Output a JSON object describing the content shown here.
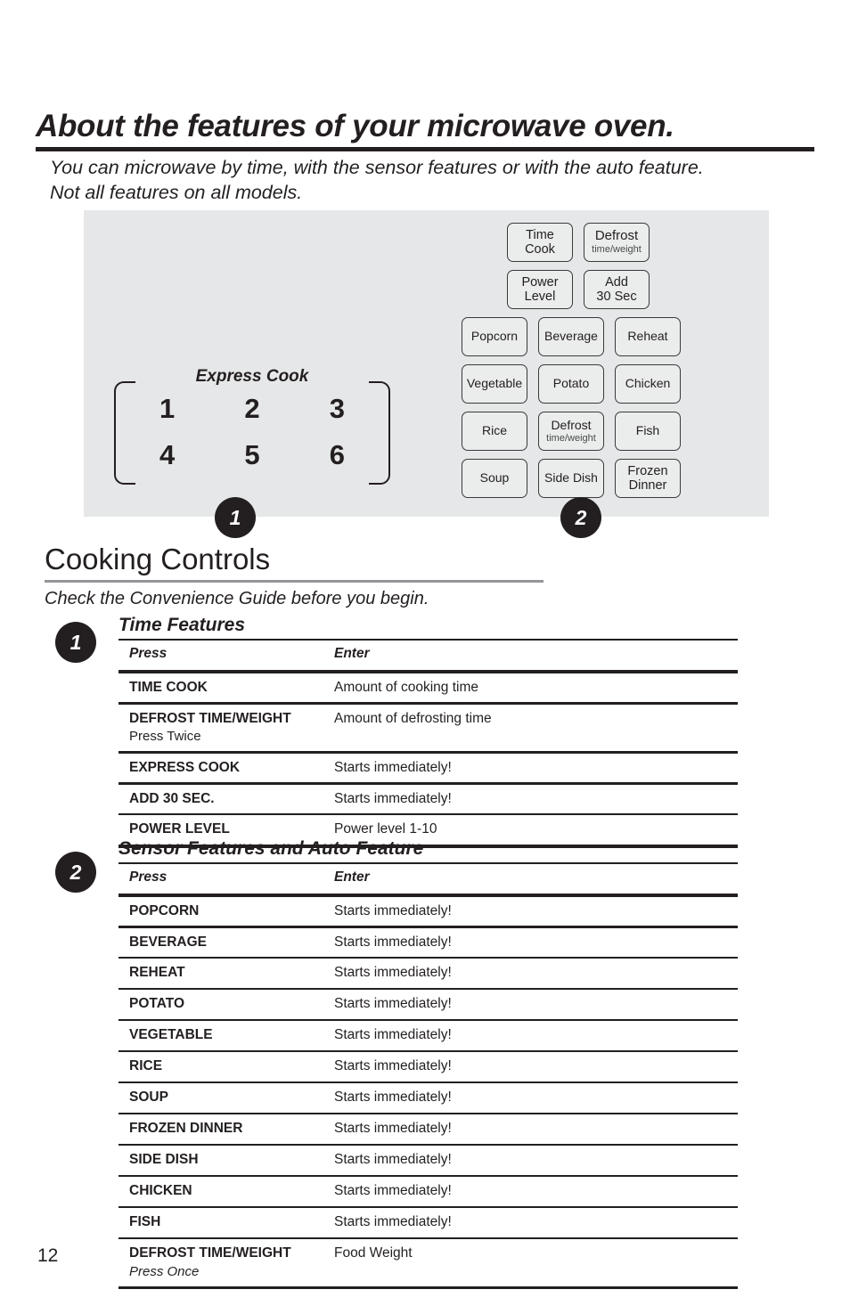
{
  "header": {
    "title": "About the features of your microwave oven.",
    "subtitle_line1": "You can microwave by time, with the sensor features or with the auto feature.",
    "subtitle_line2": "Not all features on all models."
  },
  "diagram": {
    "express": {
      "label": "Express Cook",
      "numbers": [
        "1",
        "2",
        "3",
        "4",
        "5",
        "6"
      ]
    },
    "keypad": {
      "row1": [
        {
          "main": "Time",
          "main2": "Cook",
          "sub": ""
        },
        {
          "main": "Defrost",
          "main2": "",
          "sub": "time/weight"
        }
      ],
      "row2": [
        {
          "main": "Power",
          "main2": "Level",
          "sub": ""
        },
        {
          "main": "Add",
          "main2": "30 Sec",
          "sub": ""
        }
      ],
      "row3": [
        {
          "main": "Popcorn",
          "main2": "",
          "sub": ""
        },
        {
          "main": "Beverage",
          "main2": "",
          "sub": ""
        },
        {
          "main": "Reheat",
          "main2": "",
          "sub": ""
        }
      ],
      "row4": [
        {
          "main": "Vegetable",
          "main2": "",
          "sub": ""
        },
        {
          "main": "Potato",
          "main2": "",
          "sub": ""
        },
        {
          "main": "Chicken",
          "main2": "",
          "sub": ""
        }
      ],
      "row5": [
        {
          "main": "Rice",
          "main2": "",
          "sub": ""
        },
        {
          "main": "Defrost",
          "main2": "",
          "sub": "time/weight"
        },
        {
          "main": "Fish",
          "main2": "",
          "sub": ""
        }
      ],
      "row6": [
        {
          "main": "Soup",
          "main2": "",
          "sub": ""
        },
        {
          "main": "Side Dish",
          "main2": "",
          "sub": ""
        },
        {
          "main": "Frozen",
          "main2": "Dinner",
          "sub": ""
        }
      ]
    },
    "badge_1": "1",
    "badge_2": "2"
  },
  "cooking_controls": {
    "title": "Cooking Controls",
    "subtitle": "Check the Convenience Guide before you begin."
  },
  "time_features": {
    "badge": "1",
    "heading": "Time Features",
    "columns": {
      "press": "Press",
      "enter": "Enter"
    },
    "rows": [
      {
        "press": "TIME COOK",
        "note": "",
        "note_italic": false,
        "enter": "Amount of cooking time"
      },
      {
        "press": "DEFROST TIME/WEIGHT",
        "note": "Press Twice",
        "note_italic": false,
        "enter": "Amount of defrosting time"
      },
      {
        "press": "EXPRESS COOK",
        "note": "",
        "note_italic": false,
        "enter": "Starts immediately!"
      },
      {
        "press": "ADD 30 SEC.",
        "note": "",
        "note_italic": false,
        "enter": "Starts immediately!"
      },
      {
        "press": "POWER LEVEL",
        "note": "",
        "note_italic": false,
        "enter": "Power level 1-10"
      }
    ]
  },
  "sensor_features": {
    "badge": "2",
    "heading": "Sensor Features and Auto Feature",
    "columns": {
      "press": "Press",
      "enter": "Enter"
    },
    "rows": [
      {
        "press": "POPCORN",
        "note": "",
        "note_italic": false,
        "enter": "Starts immediately!"
      },
      {
        "press": "BEVERAGE",
        "note": "",
        "note_italic": false,
        "enter": "Starts immediately!"
      },
      {
        "press": "REHEAT",
        "note": "",
        "note_italic": false,
        "enter": "Starts immediately!"
      },
      {
        "press": "POTATO",
        "note": "",
        "note_italic": false,
        "enter": "Starts immediately!"
      },
      {
        "press": "VEGETABLE",
        "note": "",
        "note_italic": false,
        "enter": "Starts immediately!"
      },
      {
        "press": "RICE",
        "note": "",
        "note_italic": false,
        "enter": "Starts immediately!"
      },
      {
        "press": "SOUP",
        "note": "",
        "note_italic": false,
        "enter": "Starts immediately!"
      },
      {
        "press": "FROZEN DINNER",
        "note": "",
        "note_italic": false,
        "enter": "Starts immediately!"
      },
      {
        "press": "SIDE DISH",
        "note": "",
        "note_italic": false,
        "enter": "Starts immediately!"
      },
      {
        "press": "CHICKEN",
        "note": "",
        "note_italic": false,
        "enter": "Starts immediately!"
      },
      {
        "press": "FISH",
        "note": "",
        "note_italic": false,
        "enter": "Starts immediately!"
      },
      {
        "press": "DEFROST TIME/WEIGHT",
        "note": "Press Once",
        "note_italic": true,
        "enter": "Food Weight"
      }
    ]
  },
  "footer": {
    "page_number": "12"
  },
  "colors": {
    "ink": "#231f20",
    "panel_bg": "#e6e7e8",
    "button_bg": "#ebecec",
    "button_border": "#3a3a3a",
    "rule_gray": "#939598"
  }
}
